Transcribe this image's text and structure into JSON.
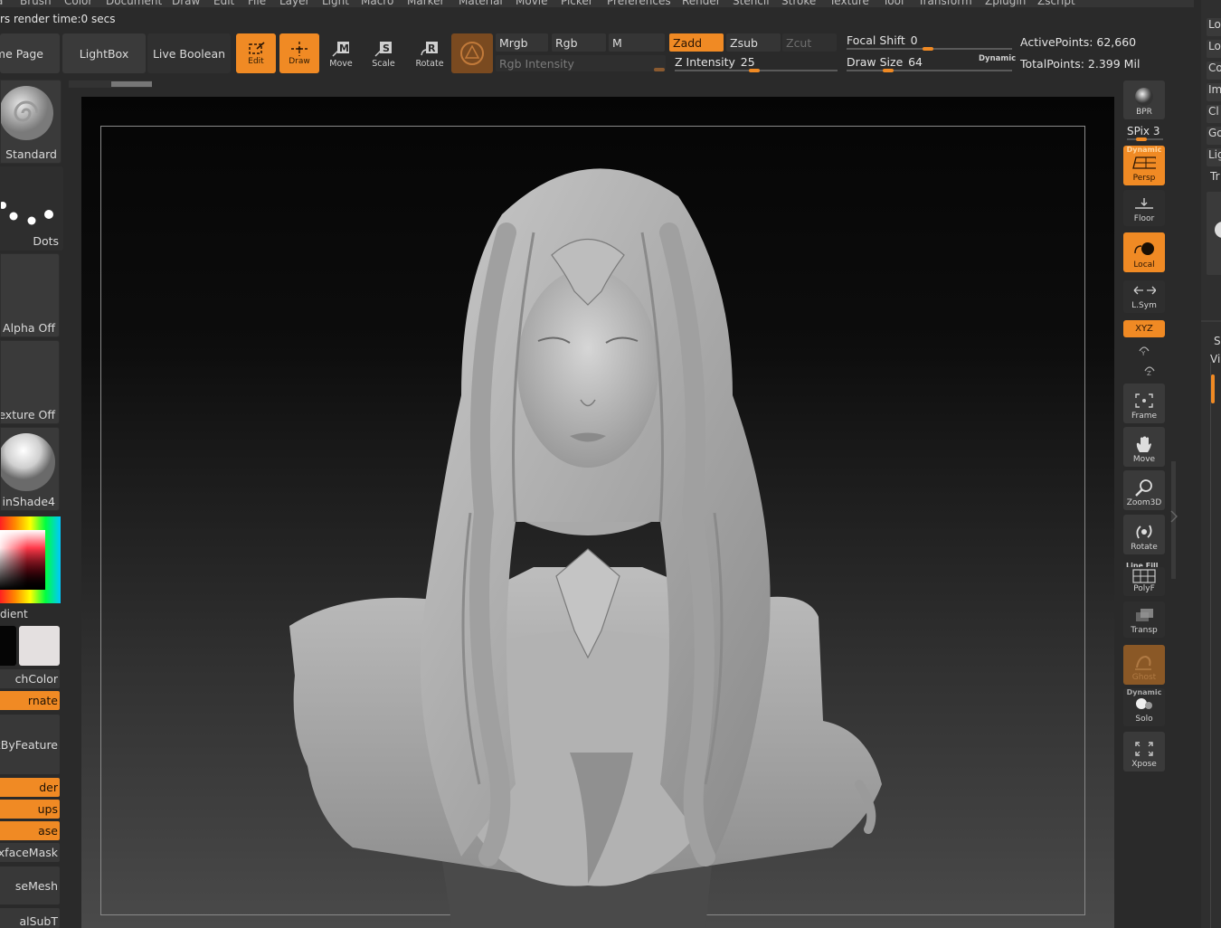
{
  "menu": [
    "a",
    "Brush",
    "Color",
    "Document",
    "Draw",
    "Edit",
    "File",
    "Layer",
    "Light",
    "Macro",
    "Marker",
    "Material",
    "Movie",
    "Picker",
    "Preferences",
    "Render",
    "Stencil",
    "Stroke",
    "Texture",
    "Tool",
    "Transform",
    "Zplugin",
    "Zscript"
  ],
  "status_text": "rs render time:0 secs",
  "toolbar": {
    "home_page": "me Page",
    "lightbox": "LightBox",
    "live_boolean": "Live Boolean",
    "edit": "Edit",
    "draw": "Draw",
    "move": "Move",
    "scale": "Scale",
    "rotate": "Rotate",
    "mrgb": "Mrgb",
    "rgb": "Rgb",
    "m": "M",
    "zadd": "Zadd",
    "zsub": "Zsub",
    "zcut": "Zcut",
    "rgb_intensity": "Rgb Intensity",
    "z_intensity_label": "Z Intensity",
    "z_intensity_value": "25",
    "focal_shift_label": "Focal Shift",
    "focal_shift_value": "0",
    "draw_size_label": "Draw Size",
    "draw_size_value": "64",
    "dynamic": "Dynamic",
    "active_points": "ActivePoints: 62,660",
    "total_points": "TotalPoints: 2.399 Mil"
  },
  "left_shelf": {
    "brush": "Standard",
    "stroke": "Dots",
    "alpha": "Alpha Off",
    "texture": "Texture Off",
    "material": "inShade4",
    "gradient": "dient",
    "switch_color": "chColor",
    "alternate": "rnate",
    "mask_by_feature": "kByFeature",
    "border": "der",
    "groups": "ups",
    "crease": "ase",
    "backface_mask": "xfaceMask",
    "close_mesh": "seMesh",
    "last": "alSubT"
  },
  "right_shelf": {
    "bpr": "BPR",
    "spix_label": "SPix",
    "spix_value": "3",
    "dynamic_persp": "Dynamic",
    "persp": "Persp",
    "floor": "Floor",
    "local": "Local",
    "lsym": "L.Sym",
    "xyz": "XYZ",
    "frame": "Frame",
    "move": "Move",
    "zoom3d": "Zoom3D",
    "rotate": "Rotate",
    "line_fill": "Line Fill",
    "polyf": "PolyF",
    "transp": "Transp",
    "ghost": "Ghost",
    "dynamic_solo": "Dynamic",
    "solo": "Solo",
    "xpose": "Xpose"
  },
  "right_panel": [
    "Lo",
    "Lo",
    "Co",
    "Im",
    "Cl",
    "Go",
    "Lig",
    "Tr",
    "S",
    "Vi"
  ],
  "colors": {
    "accent": "#f08a24",
    "bg": "#2a2a2a",
    "button": "#3a3a3a"
  }
}
